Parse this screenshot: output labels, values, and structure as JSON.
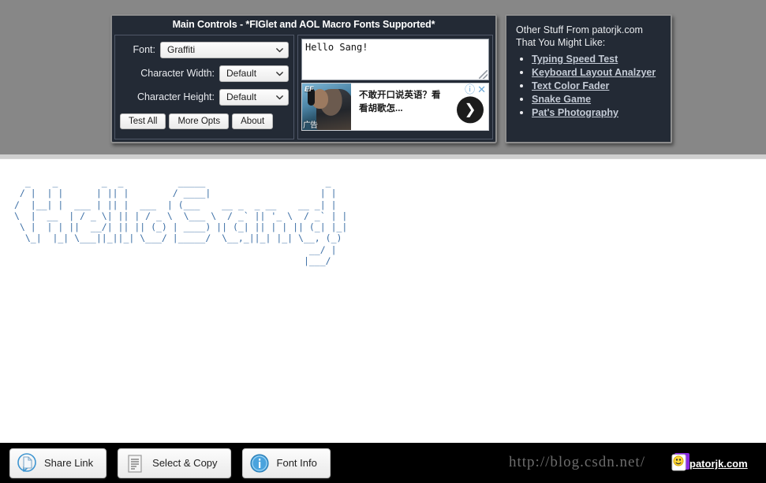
{
  "main_panel": {
    "title": "Main Controls - *FIGlet and AOL Macro Fonts Supported*",
    "font_label": "Font:",
    "font_value": "Graffiti",
    "char_width_label": "Character Width:",
    "char_width_value": "Default",
    "char_height_label": "Character Height:",
    "char_height_value": "Default",
    "buttons": {
      "test_all": "Test All",
      "more_opts": "More Opts",
      "about": "About"
    }
  },
  "input": {
    "text_value": "Hello Sang!"
  },
  "ad": {
    "brand": "EF",
    "headline_line1": "不敢开口说英语？看",
    "headline_line2": "看胡歌怎...",
    "label": "广告",
    "info_icon": "ⓘ",
    "close_icon": "✕",
    "arrow_icon": "❯"
  },
  "side_panel": {
    "heading": "Other Stuff From patorjk.com That You Might Like:",
    "links": [
      "Typing Speed Test",
      "Keyboard Layout Analzyer",
      "Text Color Fader",
      "Snake Game",
      "Pat's Photography"
    ]
  },
  "ascii_art": {
    "text": "  _    _        _  _          _____                      _ \n / |  | |      | || |        / ____|                    | |\n/  |__| |  ___ | || |  ___  | (___    __ _  _ __    __ _| |\n\\  |  __  | / _ \\| || | / _ \\  \\___ \\  / _` || '_ \\  / _` | |\n \\ |  | | ||  __/| || || (_) | ____) || (_| || | | || (_| |_|\n  \\_|  |_| \\___||_||_| \\___/ |_____/  \\__,_||_| |_| \\__, (_)\n                                                      __/ | \n                                                     |___/  "
  },
  "toolbar": {
    "share_link": "Share Link",
    "select_copy": "Select & Copy",
    "font_info": "Font Info"
  },
  "watermark": {
    "url": "http://blog.csdn.net/",
    "site": "patorjk.com"
  },
  "colors": {
    "panel_bg": "#232a35",
    "page_bg": "#878787",
    "art_color": "#3b6ea5",
    "link_color": "#c4cbd6",
    "bottom_bar": "#000000"
  }
}
